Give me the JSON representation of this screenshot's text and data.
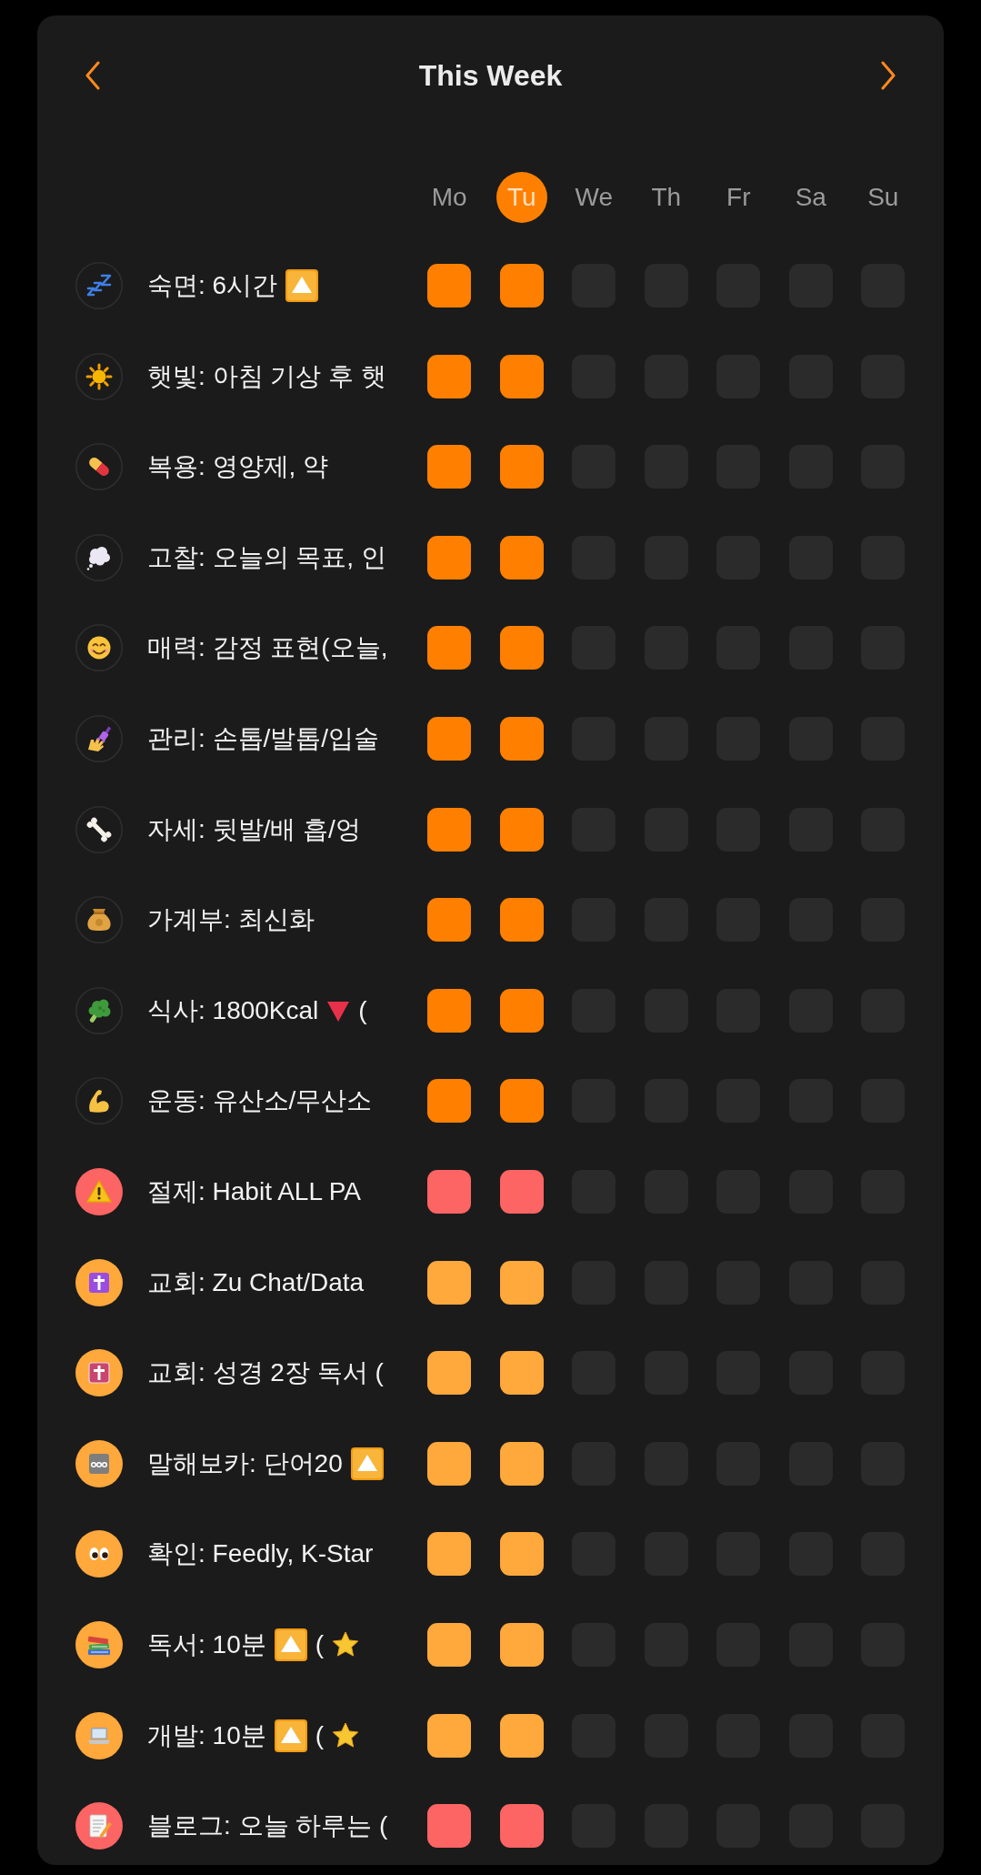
{
  "header": {
    "title": "This Week"
  },
  "days": [
    {
      "label": "Mo",
      "selected": false
    },
    {
      "label": "Tu",
      "selected": true
    },
    {
      "label": "We",
      "selected": false
    },
    {
      "label": "Th",
      "selected": false
    },
    {
      "label": "Fr",
      "selected": false
    },
    {
      "label": "Sa",
      "selected": false
    },
    {
      "label": "Su",
      "selected": false
    }
  ],
  "habits": [
    {
      "parts": [
        {
          "kind": "text",
          "text": "숙면: 6시간"
        },
        {
          "kind": "up-mark"
        }
      ],
      "color": "#ff8000",
      "icon_filled": false,
      "checks": [
        {
          "checked": true
        },
        {
          "checked": true
        },
        {
          "checked": false
        },
        {
          "checked": false
        },
        {
          "checked": false
        },
        {
          "checked": false
        },
        {
          "checked": false
        }
      ]
    },
    {
      "parts": [
        {
          "kind": "text",
          "text": "햇빛: 아침 기상 후 햇"
        }
      ],
      "color": "#ff8000",
      "icon_filled": false,
      "checks": [
        {
          "checked": true
        },
        {
          "checked": true
        },
        {
          "checked": false
        },
        {
          "checked": false
        },
        {
          "checked": false
        },
        {
          "checked": false
        },
        {
          "checked": false
        }
      ]
    },
    {
      "parts": [
        {
          "kind": "text",
          "text": "복용: 영양제, 약"
        }
      ],
      "color": "#ff8000",
      "icon_filled": false,
      "checks": [
        {
          "checked": true
        },
        {
          "checked": true
        },
        {
          "checked": false
        },
        {
          "checked": false
        },
        {
          "checked": false
        },
        {
          "checked": false
        },
        {
          "checked": false
        }
      ]
    },
    {
      "parts": [
        {
          "kind": "text",
          "text": "고찰: 오늘의 목표, 인"
        }
      ],
      "color": "#ff8000",
      "icon_filled": false,
      "checks": [
        {
          "checked": true
        },
        {
          "checked": true
        },
        {
          "checked": false
        },
        {
          "checked": false
        },
        {
          "checked": false
        },
        {
          "checked": false
        },
        {
          "checked": false
        }
      ]
    },
    {
      "parts": [
        {
          "kind": "text",
          "text": "매력: 감정 표현(오늘,"
        }
      ],
      "color": "#ff8000",
      "icon_filled": false,
      "checks": [
        {
          "checked": true
        },
        {
          "checked": true
        },
        {
          "checked": false
        },
        {
          "checked": false
        },
        {
          "checked": false
        },
        {
          "checked": false
        },
        {
          "checked": false
        }
      ]
    },
    {
      "parts": [
        {
          "kind": "text",
          "text": "관리: 손톱/발톱/입술"
        }
      ],
      "color": "#ff8000",
      "icon_filled": false,
      "checks": [
        {
          "checked": true
        },
        {
          "checked": true
        },
        {
          "checked": false
        },
        {
          "checked": false
        },
        {
          "checked": false
        },
        {
          "checked": false
        },
        {
          "checked": false
        }
      ]
    },
    {
      "parts": [
        {
          "kind": "text",
          "text": "자세: 뒷발/배 흡/엉"
        }
      ],
      "color": "#ff8000",
      "icon_filled": false,
      "checks": [
        {
          "checked": true
        },
        {
          "checked": true
        },
        {
          "checked": false
        },
        {
          "checked": false
        },
        {
          "checked": false
        },
        {
          "checked": false
        },
        {
          "checked": false
        }
      ]
    },
    {
      "parts": [
        {
          "kind": "text",
          "text": "가계부: 최신화"
        }
      ],
      "color": "#ff8000",
      "icon_filled": false,
      "checks": [
        {
          "checked": true
        },
        {
          "checked": true
        },
        {
          "checked": false
        },
        {
          "checked": false
        },
        {
          "checked": false
        },
        {
          "checked": false
        },
        {
          "checked": false
        }
      ]
    },
    {
      "parts": [
        {
          "kind": "text",
          "text": "식사: 1800Kcal"
        },
        {
          "kind": "down-mark"
        },
        {
          "kind": "text",
          "text": "("
        }
      ],
      "color": "#ff8000",
      "icon_filled": false,
      "checks": [
        {
          "checked": true
        },
        {
          "checked": true
        },
        {
          "checked": false
        },
        {
          "checked": false
        },
        {
          "checked": false
        },
        {
          "checked": false
        },
        {
          "checked": false
        }
      ]
    },
    {
      "parts": [
        {
          "kind": "text",
          "text": "운동: 유산소/무산소"
        }
      ],
      "color": "#ff8000",
      "icon_filled": false,
      "checks": [
        {
          "checked": true
        },
        {
          "checked": true
        },
        {
          "checked": false
        },
        {
          "checked": false
        },
        {
          "checked": false
        },
        {
          "checked": false
        },
        {
          "checked": false
        }
      ]
    },
    {
      "parts": [
        {
          "kind": "text",
          "text": "절제: Habit ALL PA"
        }
      ],
      "color": "#fd6464",
      "icon_filled": true,
      "checks": [
        {
          "checked": true
        },
        {
          "checked": true
        },
        {
          "checked": false
        },
        {
          "checked": false
        },
        {
          "checked": false
        },
        {
          "checked": false
        },
        {
          "checked": false
        }
      ]
    },
    {
      "parts": [
        {
          "kind": "text",
          "text": "교회: Zu Chat/Data"
        }
      ],
      "color": "#ffa83c",
      "icon_filled": true,
      "checks": [
        {
          "checked": true
        },
        {
          "checked": true
        },
        {
          "checked": false
        },
        {
          "checked": false
        },
        {
          "checked": false
        },
        {
          "checked": false
        },
        {
          "checked": false
        }
      ]
    },
    {
      "parts": [
        {
          "kind": "text",
          "text": "교회: 성경 2장 독서 ("
        }
      ],
      "color": "#ffa83c",
      "icon_filled": true,
      "checks": [
        {
          "checked": true
        },
        {
          "checked": true
        },
        {
          "checked": false
        },
        {
          "checked": false
        },
        {
          "checked": false
        },
        {
          "checked": false
        },
        {
          "checked": false
        }
      ]
    },
    {
      "parts": [
        {
          "kind": "text",
          "text": "말해보카: 단어20"
        },
        {
          "kind": "up-mark"
        }
      ],
      "color": "#ffa83c",
      "icon_filled": true,
      "checks": [
        {
          "checked": true
        },
        {
          "checked": true
        },
        {
          "checked": false
        },
        {
          "checked": false
        },
        {
          "checked": false
        },
        {
          "checked": false
        },
        {
          "checked": false
        }
      ]
    },
    {
      "parts": [
        {
          "kind": "text",
          "text": "확인: Feedly, K-Star"
        }
      ],
      "color": "#ffa83c",
      "icon_filled": true,
      "checks": [
        {
          "checked": true
        },
        {
          "checked": true
        },
        {
          "checked": false
        },
        {
          "checked": false
        },
        {
          "checked": false
        },
        {
          "checked": false
        },
        {
          "checked": false
        }
      ]
    },
    {
      "parts": [
        {
          "kind": "text",
          "text": "독서: 10분"
        },
        {
          "kind": "up-mark"
        },
        {
          "kind": "text",
          "text": "("
        },
        {
          "kind": "star-mark"
        }
      ],
      "color": "#ffa83c",
      "icon_filled": true,
      "checks": [
        {
          "checked": true
        },
        {
          "checked": true
        },
        {
          "checked": false
        },
        {
          "checked": false
        },
        {
          "checked": false
        },
        {
          "checked": false
        },
        {
          "checked": false
        }
      ]
    },
    {
      "parts": [
        {
          "kind": "text",
          "text": "개발: 10분"
        },
        {
          "kind": "up-mark"
        },
        {
          "kind": "text",
          "text": "("
        },
        {
          "kind": "star-mark"
        }
      ],
      "color": "#ffa83c",
      "icon_filled": true,
      "checks": [
        {
          "checked": true
        },
        {
          "checked": true
        },
        {
          "checked": false
        },
        {
          "checked": false
        },
        {
          "checked": false
        },
        {
          "checked": false
        },
        {
          "checked": false
        }
      ]
    },
    {
      "parts": [
        {
          "kind": "text",
          "text": "블로그: 오늘 하루는 ("
        }
      ],
      "color": "#fd6464",
      "icon_filled": true,
      "checks": [
        {
          "checked": true
        },
        {
          "checked": true
        },
        {
          "checked": false
        },
        {
          "checked": false
        },
        {
          "checked": false
        },
        {
          "checked": false
        },
        {
          "checked": false
        }
      ]
    }
  ]
}
